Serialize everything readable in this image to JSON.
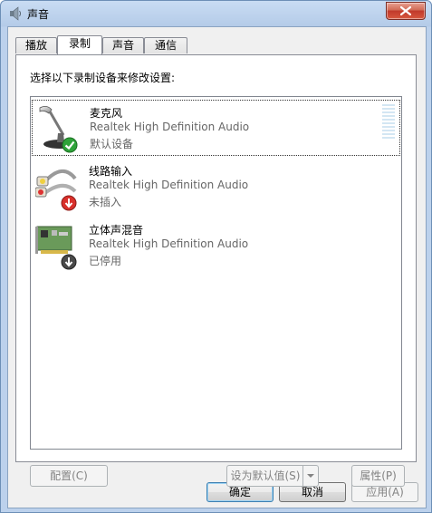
{
  "window": {
    "title": "声音",
    "close_label": "关闭"
  },
  "tabs": [
    {
      "label": "播放"
    },
    {
      "label": "录制"
    },
    {
      "label": "声音"
    },
    {
      "label": "通信"
    }
  ],
  "panel": {
    "instruction": "选择以下录制设备来修改设置:",
    "devices": [
      {
        "name": "麦克风",
        "driver": "Realtek High Definition Audio",
        "status": "默认设备",
        "icon": "microphone-icon",
        "badge": "default-check-icon"
      },
      {
        "name": "线路输入",
        "driver": "Realtek High Definition Audio",
        "status": "未插入",
        "icon": "line-in-cable-icon",
        "badge": "unplugged-arrow-icon"
      },
      {
        "name": "立体声混音",
        "driver": "Realtek High Definition Audio",
        "status": "已停用",
        "icon": "sound-card-icon",
        "badge": "disabled-arrow-icon"
      }
    ],
    "buttons": {
      "configure": "配置(C)",
      "set_default": "设为默认值(S)",
      "properties": "属性(P)"
    }
  },
  "footer": {
    "ok": "确定",
    "cancel": "取消",
    "apply": "应用(A)"
  },
  "colors": {
    "titlebar": "#bcd1ec",
    "close_button": "#c0392b",
    "check_badge": "#2fa33a",
    "arrow_badge": "#d9302b",
    "level_meter": "#d3e6f3"
  }
}
